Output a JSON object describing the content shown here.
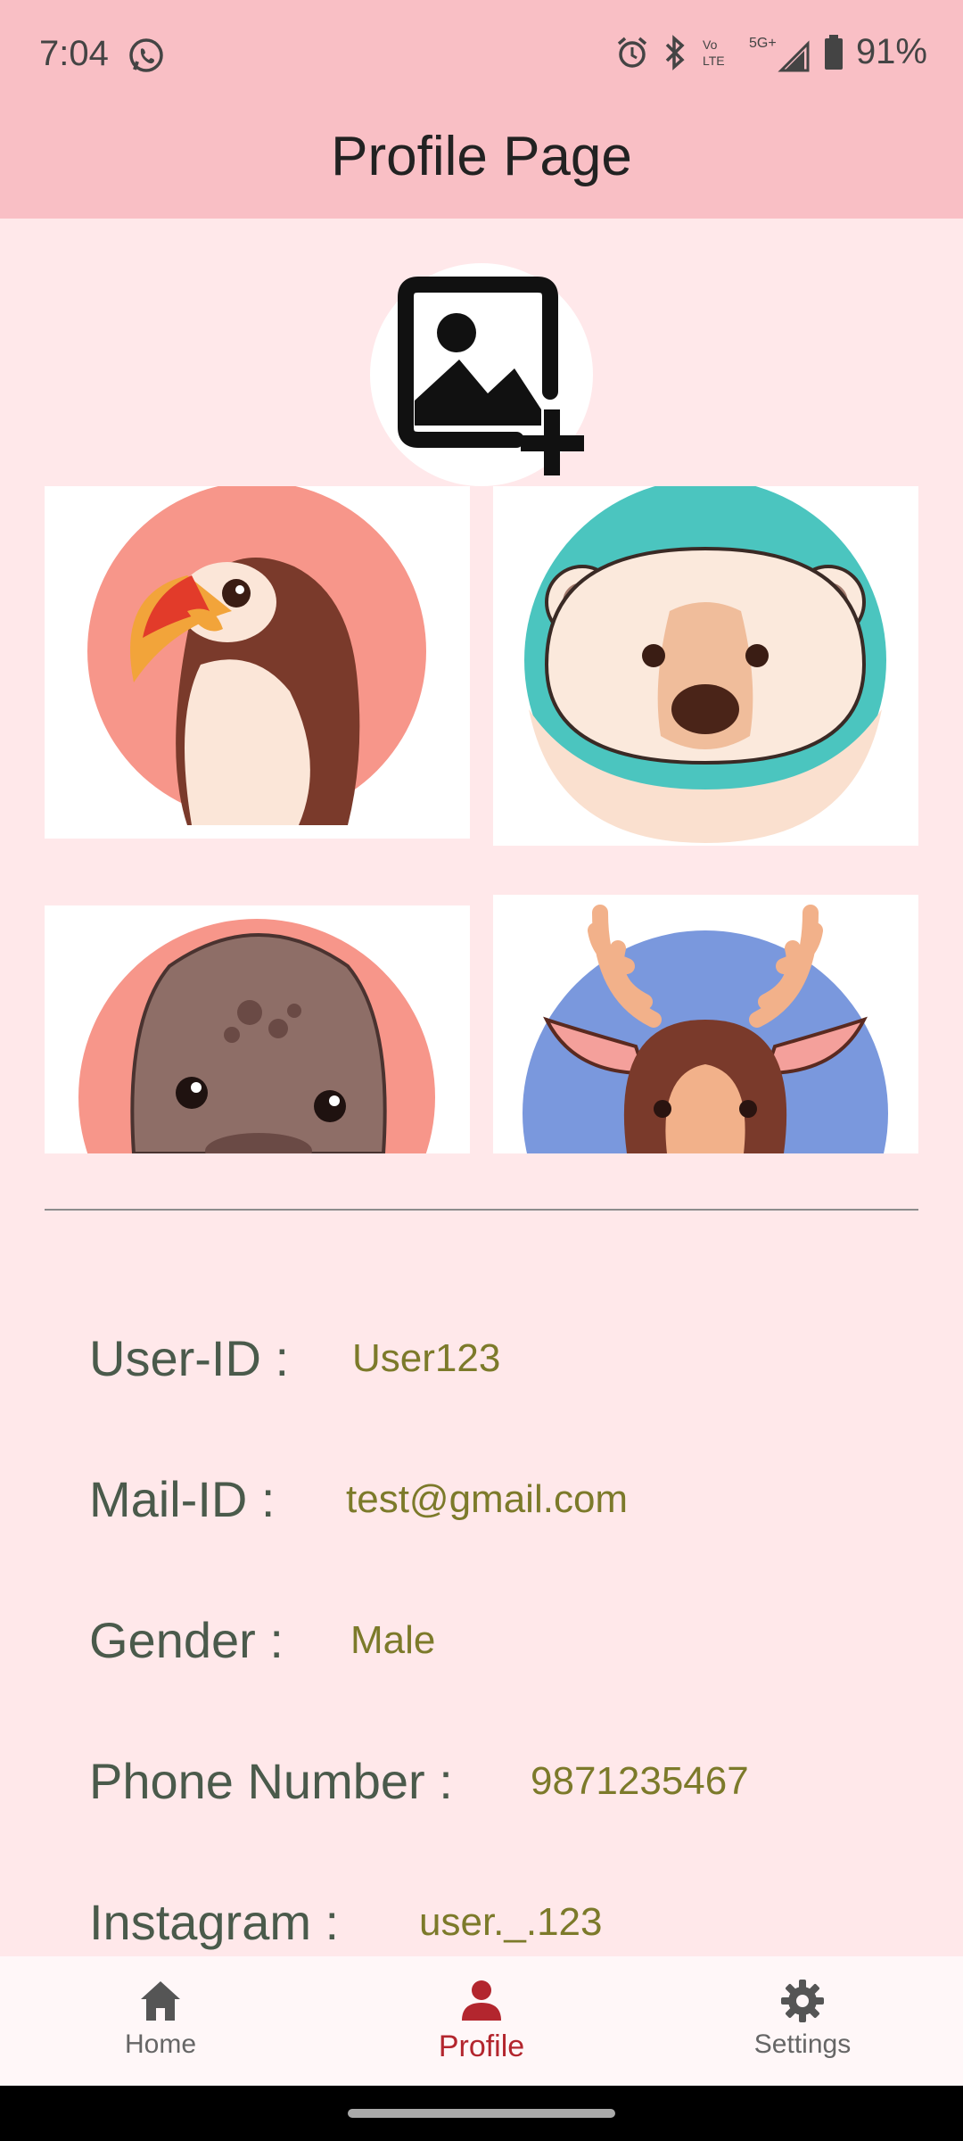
{
  "status_bar": {
    "time": "7:04",
    "battery": "91%"
  },
  "app_bar": {
    "title": "Profile Page"
  },
  "avatar": {
    "icon": "add-photo-icon"
  },
  "grid": [
    {
      "name": "puffin",
      "bg": "#f7968a"
    },
    {
      "name": "polar-bear",
      "bg": "#4bc5bf"
    },
    {
      "name": "seal",
      "bg": "#f7968a"
    },
    {
      "name": "deer",
      "bg": "#7a98dd"
    }
  ],
  "profile": {
    "user_id_label": "User-ID :",
    "user_id_value": "User123",
    "mail_label": "Mail-ID :",
    "mail_value": "test@gmail.com",
    "gender_label": "Gender :",
    "gender_value": "Male",
    "phone_label": "Phone Number :",
    "phone_value": "9871235467",
    "instagram_label": "Instagram :",
    "instagram_value": "user._.123"
  },
  "nav": {
    "home": "Home",
    "profile": "Profile",
    "settings": "Settings",
    "active": "profile",
    "active_color": "#b3262e"
  },
  "colors": {
    "app_bar": "#f9bfc5",
    "background": "#ffe8ea",
    "label": "#4a5a4b",
    "value": "#7c7a2a"
  }
}
